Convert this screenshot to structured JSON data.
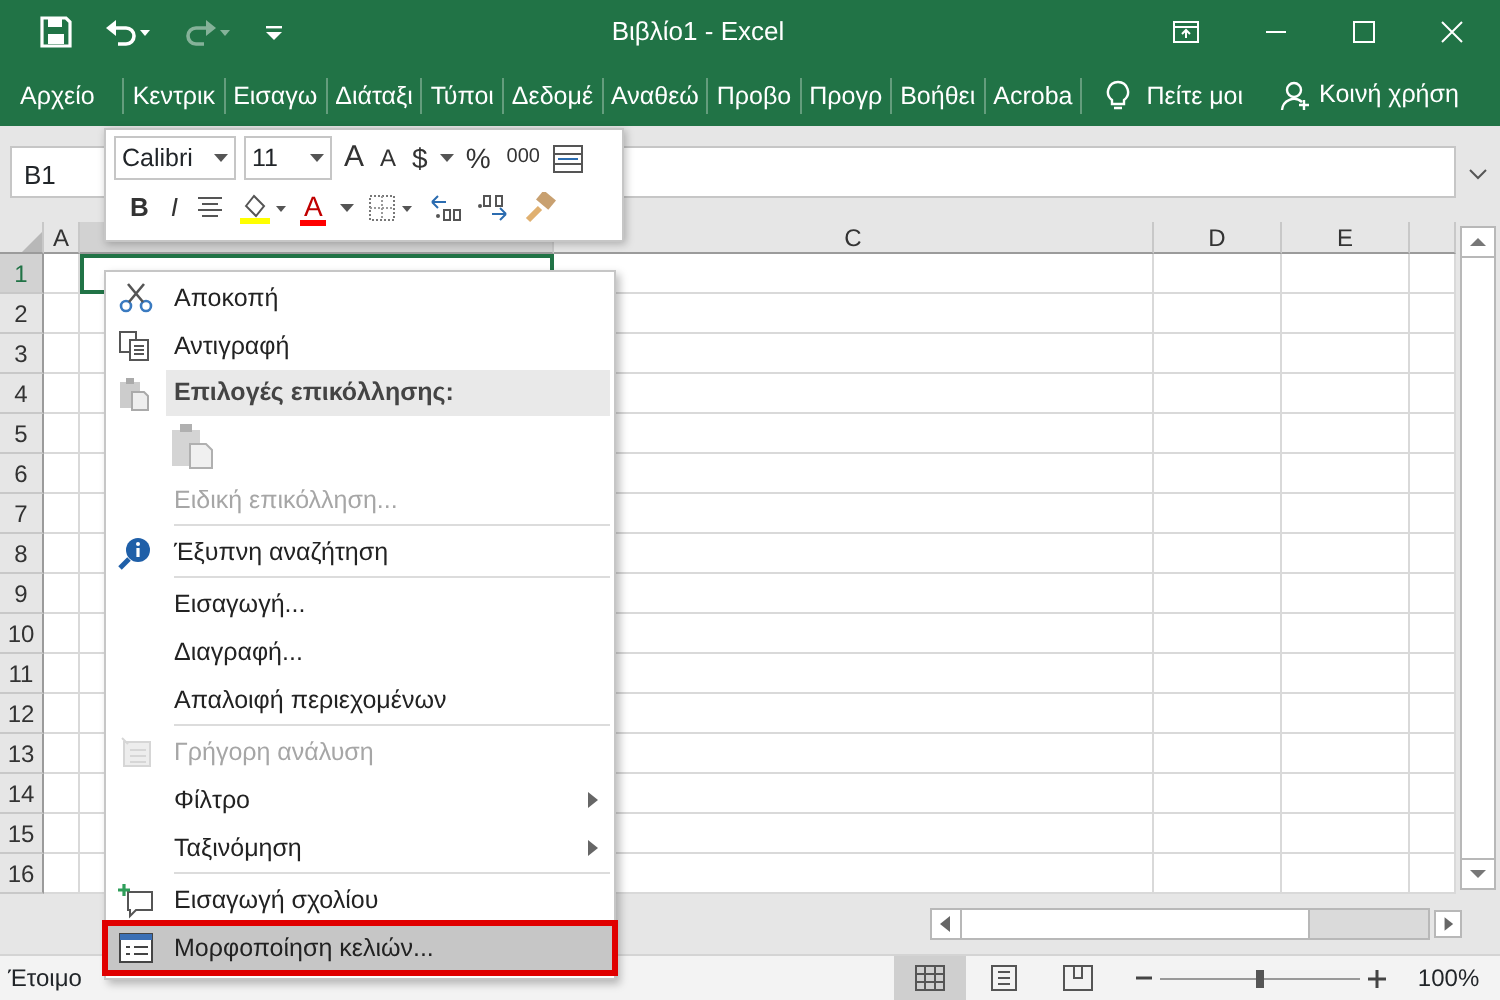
{
  "title_bar": {
    "title": "Βιβλίο1 - Excel"
  },
  "ribbon_tabs": [
    {
      "label": "Αρχείο"
    },
    {
      "label": "Κεντρικ"
    },
    {
      "label": "Εισαγω"
    },
    {
      "label": "Διάταξι"
    },
    {
      "label": "Τύποι"
    },
    {
      "label": "Δεδομέ"
    },
    {
      "label": "Αναθεώ"
    },
    {
      "label": "Προβο"
    },
    {
      "label": "Προγρ"
    },
    {
      "label": "Βοήθει"
    },
    {
      "label": "Acroba"
    }
  ],
  "tell_me": "Πείτε μοι",
  "share": "Κοινή χρήση",
  "name_box": "B1",
  "mini_toolbar": {
    "font": "Calibri",
    "font_size": "11",
    "grow": "A",
    "shrink": "A",
    "currency": "$",
    "percent": "%",
    "thousands": "000",
    "bold": "B",
    "italic": "I",
    "font_color": "A"
  },
  "columns": [
    {
      "label": "A",
      "selected": false
    },
    {
      "selected": true
    },
    {
      "label": "C",
      "selected": false
    },
    {
      "label": "D",
      "selected": false
    },
    {
      "label": "E",
      "selected": false
    }
  ],
  "rows": [
    {
      "label": "1",
      "selected": true
    },
    {
      "label": "2",
      "selected": false
    },
    {
      "label": "3",
      "selected": false
    },
    {
      "label": "4",
      "selected": false
    },
    {
      "label": "5",
      "selected": false
    },
    {
      "label": "6",
      "selected": false
    },
    {
      "label": "7",
      "selected": false
    },
    {
      "label": "8",
      "selected": false
    },
    {
      "label": "9",
      "selected": false
    },
    {
      "label": "10",
      "selected": false
    },
    {
      "label": "11",
      "selected": false
    },
    {
      "label": "12",
      "selected": false
    },
    {
      "label": "13",
      "selected": false
    },
    {
      "label": "14",
      "selected": false
    },
    {
      "label": "15",
      "selected": false
    },
    {
      "label": "16",
      "selected": false
    }
  ],
  "context_menu": [
    {
      "kind": "item",
      "label": "Αποκοπή",
      "disabled": false,
      "submenu": false,
      "selected": false
    },
    {
      "kind": "item",
      "label": "Αντιγραφή",
      "disabled": false,
      "submenu": false,
      "selected": false
    },
    {
      "kind": "header",
      "label": "Επιλογές επικόλλησης:"
    },
    {
      "kind": "paste_options"
    },
    {
      "kind": "item",
      "label": "Ειδική επικόλληση...",
      "disabled": true,
      "submenu": false,
      "selected": false
    },
    {
      "kind": "separator"
    },
    {
      "kind": "item",
      "label": "Έξυπνη αναζήτηση",
      "disabled": false,
      "submenu": false,
      "selected": false
    },
    {
      "kind": "separator"
    },
    {
      "kind": "item",
      "label": "Εισαγωγή...",
      "disabled": false,
      "submenu": false,
      "selected": false
    },
    {
      "kind": "item",
      "label": "Διαγραφή...",
      "disabled": false,
      "submenu": false,
      "selected": false
    },
    {
      "kind": "item",
      "label": "Απαλοιφή περιεχομένων",
      "disabled": false,
      "submenu": false,
      "selected": false
    },
    {
      "kind": "separator"
    },
    {
      "kind": "item",
      "label": "Γρήγορη ανάλυση",
      "disabled": true,
      "submenu": false,
      "selected": false
    },
    {
      "kind": "item",
      "label": "Φίλτρο",
      "disabled": false,
      "submenu": true,
      "selected": false
    },
    {
      "kind": "item",
      "label": "Ταξινόμηση",
      "disabled": false,
      "submenu": true,
      "selected": false
    },
    {
      "kind": "separator"
    },
    {
      "kind": "item",
      "label": "Εισαγωγή σχολίου",
      "disabled": false,
      "submenu": false,
      "selected": false
    },
    {
      "kind": "item",
      "label": "Μορφοποίηση κελιών...",
      "disabled": false,
      "submenu": false,
      "selected": true,
      "outlined": true
    }
  ],
  "status_bar": {
    "text": "Έτοιμο",
    "views": [
      {
        "selected": true
      },
      {
        "selected": false
      },
      {
        "selected": false
      }
    ],
    "zoom_slider": {
      "level": 0.5
    },
    "zoom": "100%"
  }
}
